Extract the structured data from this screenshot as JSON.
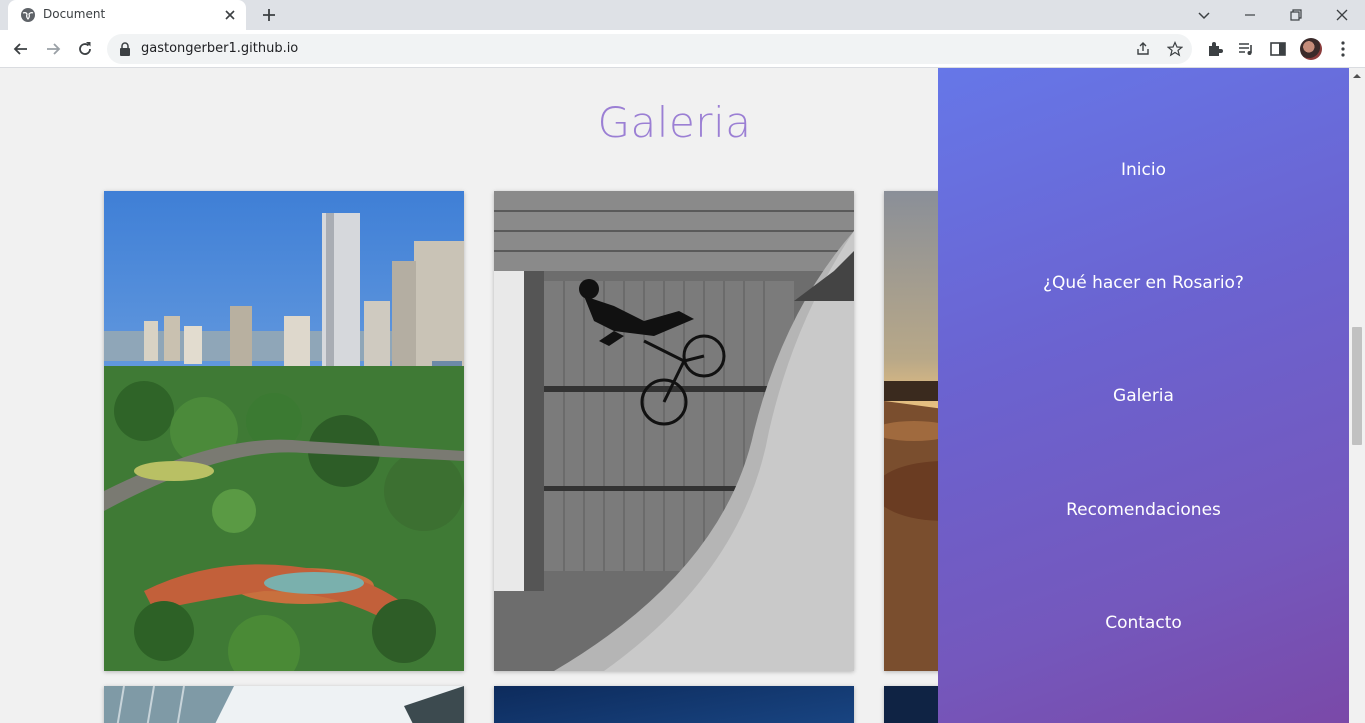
{
  "browser": {
    "tab_title": "Document",
    "url": "gastongerber1.github.io"
  },
  "page": {
    "title": "Galeria"
  },
  "menu": {
    "items": [
      {
        "label": "Inicio"
      },
      {
        "label": "¿Qué hacer en Rosario?"
      },
      {
        "label": "Galeria"
      },
      {
        "label": "Recomendaciones"
      },
      {
        "label": "Contacto"
      }
    ]
  },
  "colors": {
    "title": "#9b7fd4",
    "menu_gradient_start": "#6677e8",
    "menu_gradient_end": "#7a49a8"
  }
}
